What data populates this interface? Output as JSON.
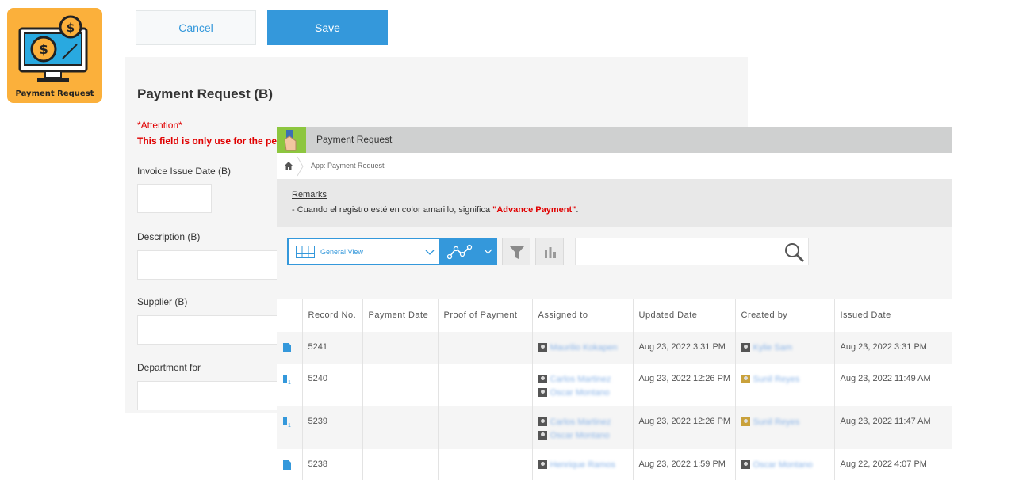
{
  "app_icon": {
    "label": "Payment Request"
  },
  "buttons": {
    "cancel": "Cancel",
    "save": "Save"
  },
  "form": {
    "title": "Payment Request (B)",
    "attention_title": "*Attention*",
    "attention_text": "This field is only use for the pe",
    "fields": {
      "invoice_issue_date": "Invoice Issue Date (B)",
      "description": "Description (B)",
      "supplier": "Supplier (B)",
      "department": "Department for"
    }
  },
  "list": {
    "app_title": "Payment Request",
    "breadcrumb": "App: Payment Request",
    "remarks_title": "Remarks",
    "remarks_prefix": "- Cuando el registro esté en color amarillo, significa ",
    "remarks_highlight": "\"Advance Payment\"",
    "remarks_suffix": ".",
    "view_name": "General View",
    "search_placeholder": "",
    "columns": [
      "",
      "Record No.",
      "Payment Date",
      "Proof of Payment",
      "Assigned to",
      "Updated Date",
      "Created by",
      "Issued Date"
    ],
    "rows": [
      {
        "record_no": "5241",
        "assigned": [
          "Maurilio Kokapen"
        ],
        "updated": "Aug 23, 2022 3:31 PM",
        "created_by": "Kylie Sam",
        "issued": "Aug 23, 2022 3:31 PM"
      },
      {
        "record_no": "5240",
        "assigned": [
          "Carlos Martinez",
          "Oscar Montano"
        ],
        "updated": "Aug 23, 2022 12:26 PM",
        "created_by": "Sunil Reyes",
        "issued": "Aug 23, 2022 11:49 AM"
      },
      {
        "record_no": "5239",
        "assigned": [
          "Carlos Martinez",
          "Oscar Montano"
        ],
        "updated": "Aug 23, 2022 12:26 PM",
        "created_by": "Sunil Reyes",
        "issued": "Aug 23, 2022 11:47 AM"
      },
      {
        "record_no": "5238",
        "assigned": [
          "Henrique Ramos"
        ],
        "updated": "Aug 23, 2022 1:59 PM",
        "created_by": "Oscar Montano",
        "issued": "Aug 22, 2022 4:07 PM"
      }
    ]
  },
  "colors": {
    "accent": "#3498db",
    "attention": "#e00000",
    "app_icon_bg": "#fbb03b",
    "header_bar": "#cfd0d0"
  }
}
